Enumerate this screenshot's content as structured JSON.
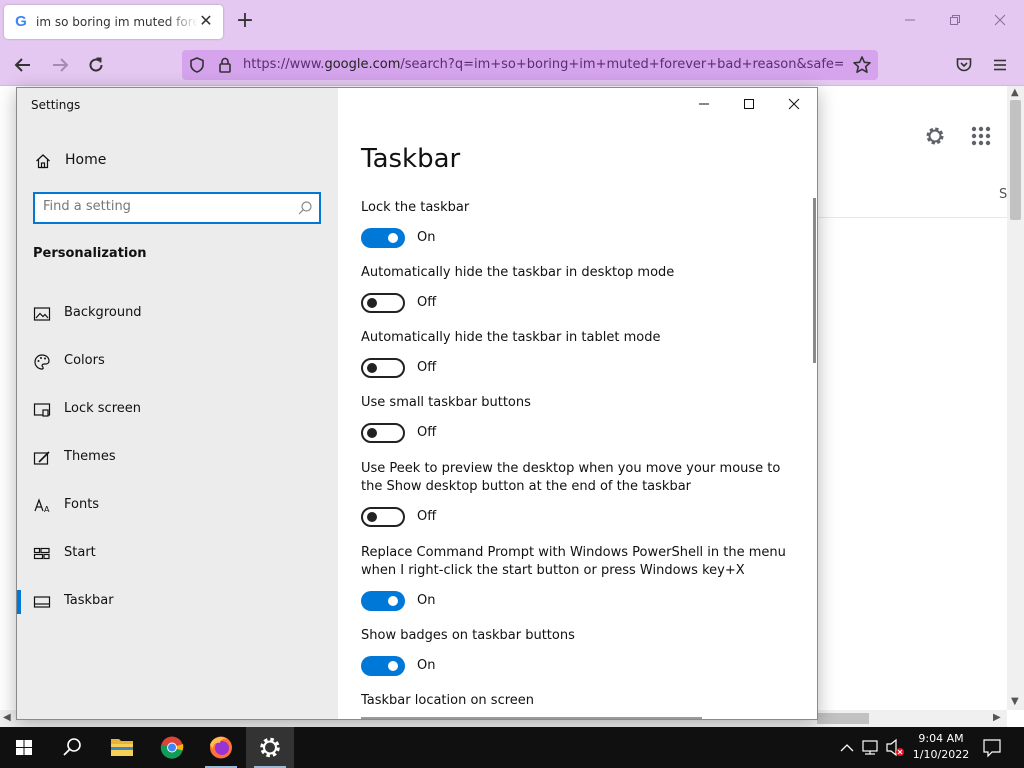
{
  "browser": {
    "tab_title": "im so boring im muted forever bad reason - Google Search",
    "tab_favicon": "G",
    "tab_close": "✕",
    "new_tab": "+",
    "url_prefix": "https://www.",
    "url_domain": "google.com",
    "url_rest": "/search?q=im+so+boring+im+muted+forever+bad+reason&safe=active",
    "page_partial_text": "S"
  },
  "settings": {
    "window_title": "Settings",
    "home_label": "Home",
    "search_placeholder": "Find a setting",
    "section_title": "Personalization",
    "nav_items": [
      {
        "label": "Background",
        "icon": "picture-icon"
      },
      {
        "label": "Colors",
        "icon": "palette-icon"
      },
      {
        "label": "Lock screen",
        "icon": "lock-screen-icon"
      },
      {
        "label": "Themes",
        "icon": "themes-icon"
      },
      {
        "label": "Fonts",
        "icon": "fonts-icon"
      },
      {
        "label": "Start",
        "icon": "start-icon"
      },
      {
        "label": "Taskbar",
        "icon": "taskbar-icon",
        "selected": true
      }
    ],
    "page_title": "Taskbar",
    "options": [
      {
        "label": "Lock the taskbar",
        "state": "On"
      },
      {
        "label": "Automatically hide the taskbar in desktop mode",
        "state": "Off"
      },
      {
        "label": "Automatically hide the taskbar in tablet mode",
        "state": "Off"
      },
      {
        "label": "Use small taskbar buttons",
        "state": "Off"
      },
      {
        "label": "Use Peek to preview the desktop when you move your mouse to the Show desktop button at the end of the taskbar",
        "state": "Off"
      },
      {
        "label": "Replace Command Prompt with Windows PowerShell in the menu when I right-click the start button or press Windows key+X",
        "state": "On"
      },
      {
        "label": "Show badges on taskbar buttons",
        "state": "On"
      }
    ],
    "location_label": "Taskbar location on screen"
  },
  "taskbar": {
    "time": "9:04 AM",
    "date": "1/10/2022"
  },
  "colors": {
    "accent": "#0078d7",
    "browser_chrome": "#e4c8f1",
    "url_bar": "#d5a4ec",
    "taskbar": "#101010"
  }
}
